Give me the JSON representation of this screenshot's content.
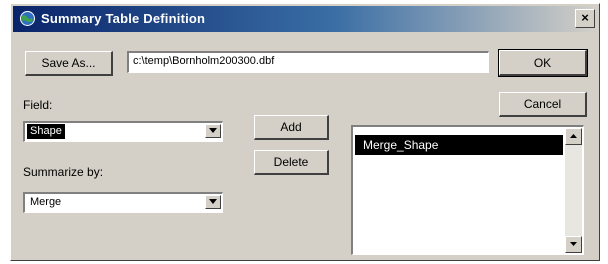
{
  "window": {
    "title": "Summary Table Definition",
    "close_glyph": "×",
    "title_icon": "globe-icon"
  },
  "buttons": {
    "save_as": "Save As...",
    "ok": "OK",
    "cancel": "Cancel",
    "add": "Add",
    "delete": "Delete"
  },
  "output_path": {
    "value": "c:\\temp\\Bornholm200300.dbf"
  },
  "field": {
    "label": "Field:",
    "selected": "Shape"
  },
  "summarize_by": {
    "label": "Summarize by:",
    "selected": "Merge"
  },
  "summary_list": {
    "items": [
      "Merge_Shape"
    ],
    "selected_index": 0
  },
  "colors": {
    "titlebar_start": "#0a246a",
    "titlebar_end": "#d4d0c8",
    "dialog_face": "#d4d0c8",
    "selection": "#000000"
  }
}
